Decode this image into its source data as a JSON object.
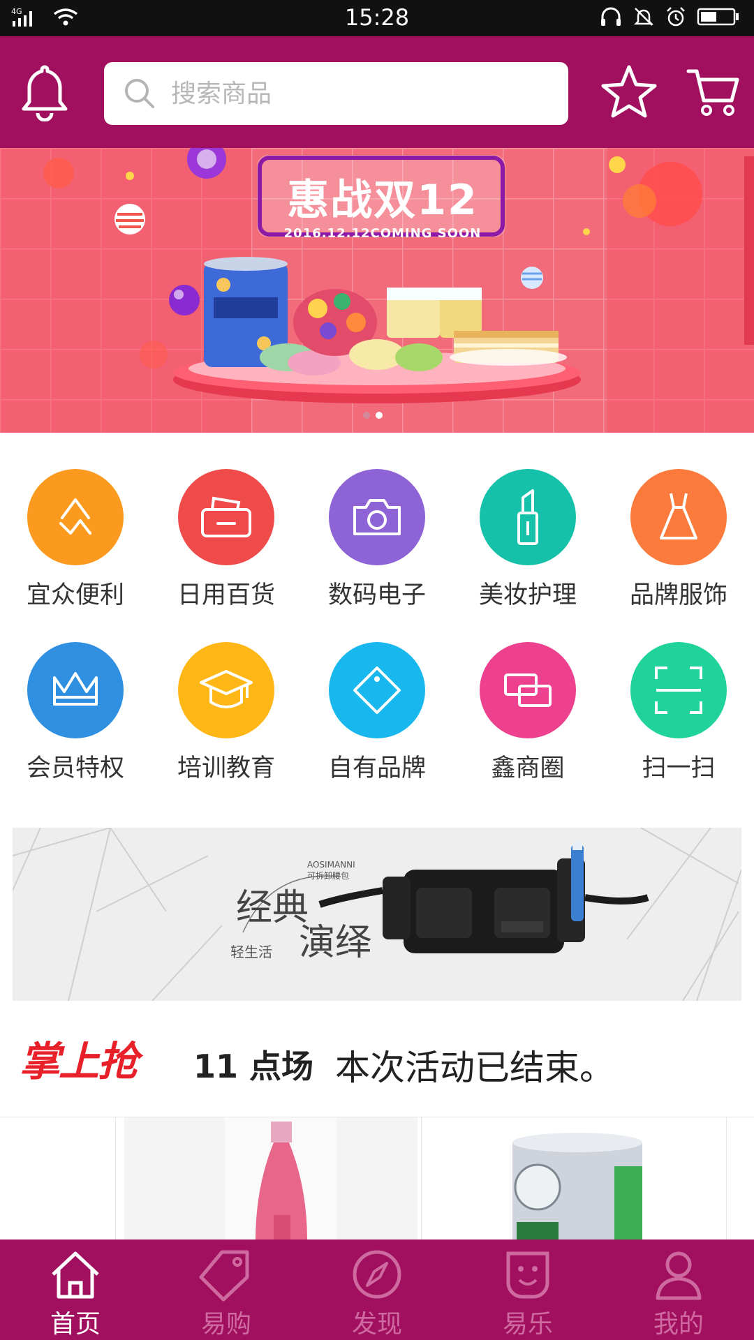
{
  "status_bar": {
    "network": "4G",
    "time": "15:28"
  },
  "header": {
    "search_placeholder": "搜索商品",
    "icons": [
      "bell-icon",
      "search-icon",
      "star-icon",
      "cart-icon"
    ]
  },
  "banner": {
    "title": "惠战双12",
    "subtitle": "2016.12.12COMING SOON",
    "slides": 2,
    "active_slide": 2
  },
  "categories": [
    {
      "label": "宜众便利",
      "color": "#fb9a1f",
      "icon": "yizhong-icon"
    },
    {
      "label": "日用百货",
      "color": "#ef4b4b",
      "icon": "box-icon"
    },
    {
      "label": "数码电子",
      "color": "#8e63d6",
      "icon": "camera-icon"
    },
    {
      "label": "美妆护理",
      "color": "#16c1a9",
      "icon": "lipstick-icon"
    },
    {
      "label": "品牌服饰",
      "color": "#fb7a3c",
      "icon": "dress-icon"
    },
    {
      "label": "会员特权",
      "color": "#2f8fe0",
      "icon": "crown-icon"
    },
    {
      "label": "培训教育",
      "color": "#ffb617",
      "icon": "graduation-cap-icon"
    },
    {
      "label": "自有品牌",
      "color": "#18b7ee",
      "icon": "tag-diamond-icon"
    },
    {
      "label": "鑫商圈",
      "color": "#ed4190",
      "icon": "link-icon"
    },
    {
      "label": "扫一扫",
      "color": "#1fd39a",
      "icon": "scan-icon"
    }
  ],
  "ad": {
    "headline_1": "经典",
    "headline_2": "演绎",
    "tagline": "轻生活",
    "brand": "AOSIMANNI",
    "brand_cn": "可拆卸腰包"
  },
  "flash_sale": {
    "logo": "掌上抢",
    "session": "11 点场",
    "status": "本次活动已结束。"
  },
  "bottom_nav": [
    {
      "label": "首页",
      "icon": "home-icon",
      "active": true
    },
    {
      "label": "易购",
      "icon": "tag-icon",
      "active": false
    },
    {
      "label": "发现",
      "icon": "compass-icon",
      "active": false
    },
    {
      "label": "易乐",
      "icon": "smile-icon",
      "active": false
    },
    {
      "label": "我的",
      "icon": "user-icon",
      "active": false
    }
  ],
  "colors": {
    "brand": "#a1105f",
    "banner_bg": "#f56b7b",
    "nav_inactive": "#cf6aa0",
    "flash_red": "#e8202a"
  }
}
